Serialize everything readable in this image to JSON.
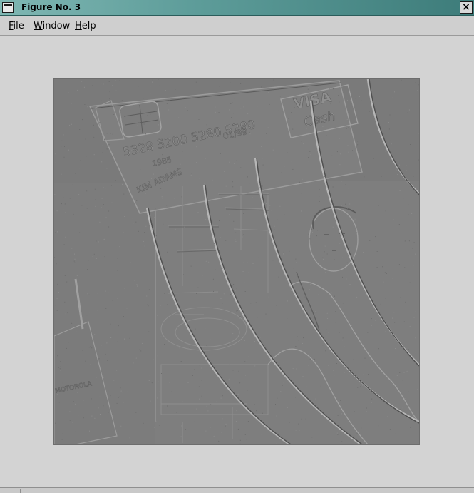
{
  "window": {
    "title": "Figure No. 3",
    "close_glyph": "×"
  },
  "menu": {
    "items": [
      {
        "label_first": "F",
        "label_rest": "ile"
      },
      {
        "label_first": "W",
        "label_rest": "indow"
      },
      {
        "label_first": "H",
        "label_rest": "elp"
      }
    ]
  },
  "figure": {
    "card_number": "5328 5200 5280 5280",
    "card_brand_line1": "VISA",
    "card_brand_line2": "Cash",
    "card_year": "1985",
    "card_expiry": "01/99",
    "card_name": "KIM ADAMS",
    "phone_brand": "MOTOROLA"
  },
  "colors": {
    "image_gray": "#7c7c7c",
    "arc_light": "#b6b6b6",
    "arc_dark": "#4f4f4f"
  }
}
